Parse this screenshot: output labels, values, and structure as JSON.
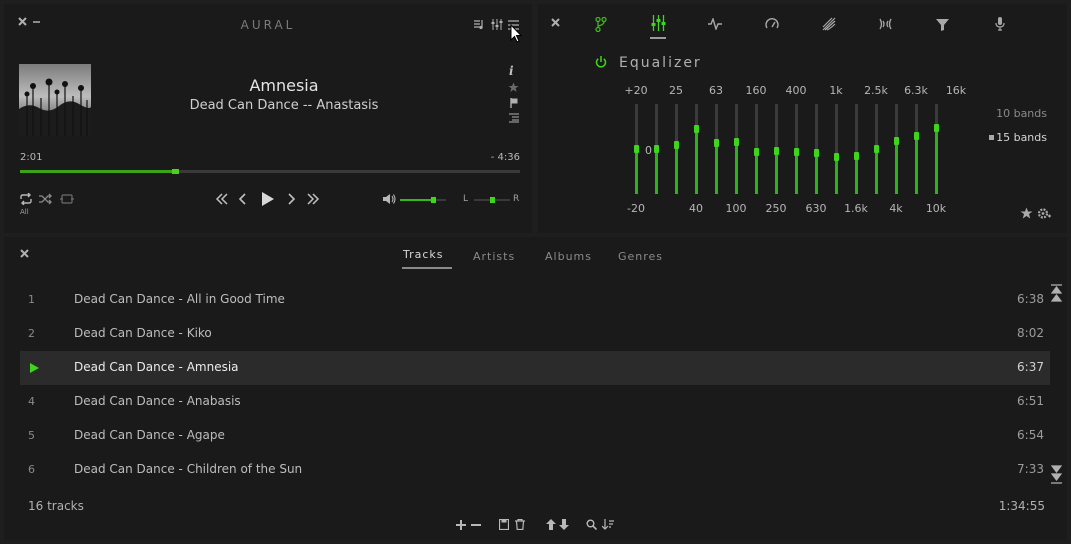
{
  "player": {
    "app_title": "AURAL",
    "track_title": "Amnesia",
    "track_subtitle": "Dead Can Dance -- Anastasis",
    "time_elapsed": "2:01",
    "time_remaining": "- 4:36",
    "progress": 0.31,
    "repeat_label": "All",
    "volume": 0.72,
    "balance_left": "L",
    "balance_right": "R",
    "balance": 0.5,
    "accent": "#3fd51d"
  },
  "equalizer": {
    "title": "Equalizer",
    "top_labels": [
      "+20",
      "25",
      "63",
      "160",
      "400",
      "1k",
      "2.5k",
      "6.3k",
      "16k"
    ],
    "bottom_labels": [
      "-20",
      "40",
      "100",
      "250",
      "630",
      "1.6k",
      "4k",
      "10k"
    ],
    "zero_label": "0",
    "band_options": [
      "10 bands",
      "15 bands"
    ],
    "selected_bands": "15 bands",
    "band_levels": [
      0.5,
      0.5,
      0.55,
      0.72,
      0.57,
      0.58,
      0.47,
      0.48,
      0.47,
      0.46,
      0.41,
      0.42,
      0.5,
      0.59,
      0.65,
      0.73
    ]
  },
  "library": {
    "tabs": [
      "Tracks",
      "Artists",
      "Albums",
      "Genres"
    ],
    "active_tab": "Tracks",
    "tracks": [
      {
        "num": "1",
        "name": "Dead Can Dance - All in Good Time",
        "duration": "6:38"
      },
      {
        "num": "2",
        "name": "Dead Can Dance - Kiko",
        "duration": "8:02"
      },
      {
        "num": "",
        "name": "Dead Can Dance - Amnesia",
        "duration": "6:37"
      },
      {
        "num": "4",
        "name": "Dead Can Dance - Anabasis",
        "duration": "6:51"
      },
      {
        "num": "5",
        "name": "Dead Can Dance - Agape",
        "duration": "6:54"
      },
      {
        "num": "6",
        "name": "Dead Can Dance - Children of the Sun",
        "duration": "7:33"
      }
    ],
    "track_count": "16 tracks",
    "total_time": "1:34:55"
  }
}
